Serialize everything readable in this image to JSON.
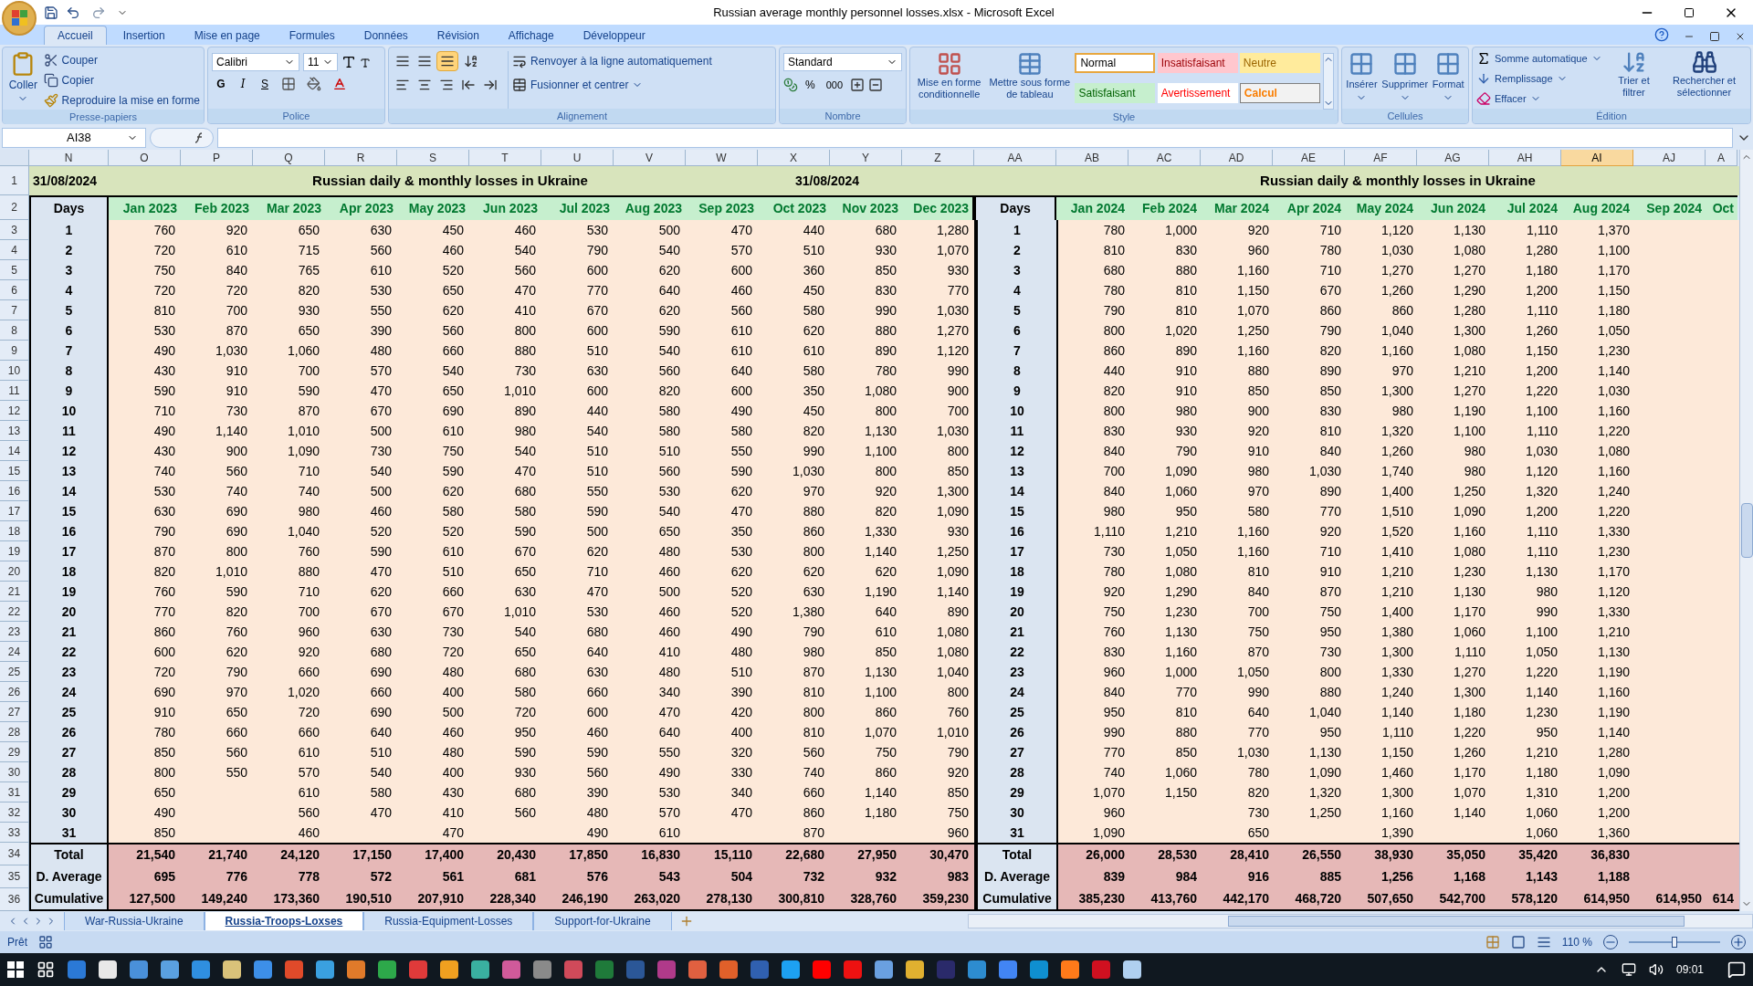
{
  "window": {
    "title": "Russian average monthly personnel losses.xlsx - Microsoft Excel"
  },
  "ribbon": {
    "tabs": [
      {
        "label": "Accueil",
        "selected": true
      },
      {
        "label": "Insertion",
        "selected": false
      },
      {
        "label": "Mise en page",
        "selected": false
      },
      {
        "label": "Formules",
        "selected": false
      },
      {
        "label": "Données",
        "selected": false
      },
      {
        "label": "Révision",
        "selected": false
      },
      {
        "label": "Affichage",
        "selected": false
      },
      {
        "label": "Développeur",
        "selected": false
      }
    ],
    "clipboard": {
      "title": "Presse-papiers",
      "paste": "Coller",
      "cut": "Couper",
      "copy": "Copier",
      "format_painter": "Reproduire la mise en forme"
    },
    "font": {
      "title": "Police",
      "family": "Calibri",
      "size": "11",
      "bold": "G",
      "italic": "I",
      "underline": "S"
    },
    "alignment": {
      "title": "Alignement",
      "wrap": "Renvoyer à la ligne automatiquement",
      "merge": "Fusionner et centrer",
      "valign": [
        {
          "selected": false
        },
        {
          "selected": false
        },
        {
          "selected": true
        }
      ]
    },
    "number": {
      "title": "Nombre",
      "format": "Standard",
      "percent": "%",
      "thousands": "000"
    },
    "styles": {
      "title": "Style",
      "conditional": "Mise en forme conditionnelle",
      "as_table": "Mettre sous forme de tableau",
      "cell_styles": [
        {
          "label": "Normal",
          "kind": "normal"
        },
        {
          "label": "Insatisfaisant",
          "kind": "bad"
        },
        {
          "label": "Neutre",
          "kind": "neutral"
        },
        {
          "label": "Satisfaisant",
          "kind": "good"
        },
        {
          "label": "Avertissement",
          "kind": "warning"
        },
        {
          "label": "Calcul",
          "kind": "calc"
        }
      ]
    },
    "cells": {
      "title": "Cellules",
      "buttons": [
        "Insérer",
        "Supprimer",
        "Format"
      ]
    },
    "editing": {
      "title": "Édition",
      "autosum": "Somme automatique",
      "fill": "Remplissage",
      "clear": "Effacer",
      "sort": "Trier et filtrer",
      "find": "Rechercher et sélectionner"
    }
  },
  "formula_bar": {
    "name_box": "AI38"
  },
  "sheet": {
    "columns": [
      {
        "label": "N",
        "selected": false
      },
      {
        "label": "O",
        "selected": false
      },
      {
        "label": "P",
        "selected": false
      },
      {
        "label": "Q",
        "selected": false
      },
      {
        "label": "R",
        "selected": false
      },
      {
        "label": "S",
        "selected": false
      },
      {
        "label": "T",
        "selected": false
      },
      {
        "label": "U",
        "selected": false
      },
      {
        "label": "V",
        "selected": false
      },
      {
        "label": "W",
        "selected": false
      },
      {
        "label": "X",
        "selected": false
      },
      {
        "label": "Y",
        "selected": false
      },
      {
        "label": "Z",
        "selected": false
      },
      {
        "label": "AA",
        "selected": false
      },
      {
        "label": "AB",
        "selected": false
      },
      {
        "label": "AC",
        "selected": false
      },
      {
        "label": "AD",
        "selected": false
      },
      {
        "label": "AE",
        "selected": false
      },
      {
        "label": "AF",
        "selected": false
      },
      {
        "label": "AG",
        "selected": false
      },
      {
        "label": "AH",
        "selected": false
      },
      {
        "label": "AI",
        "selected": true
      },
      {
        "label": "AJ",
        "selected": false
      },
      {
        "label": "A",
        "selected": false
      }
    ],
    "row_numbers": [
      "1",
      "2",
      "3",
      "4",
      "5",
      "6",
      "7",
      "8",
      "9",
      "10",
      "11",
      "12",
      "13",
      "14",
      "15",
      "16",
      "17",
      "18",
      "19",
      "20",
      "21",
      "22",
      "23",
      "24",
      "25",
      "26",
      "27",
      "28",
      "29",
      "30",
      "31",
      "32",
      "33",
      "34",
      "35",
      "36"
    ],
    "blocks": [
      {
        "date": "31/08/2024",
        "title": "Russian daily & monthly losses in Ukraine",
        "days_label": "Days",
        "days": [
          "1",
          "2",
          "3",
          "4",
          "5",
          "6",
          "7",
          "8",
          "9",
          "10",
          "11",
          "12",
          "13",
          "14",
          "15",
          "16",
          "17",
          "18",
          "19",
          "20",
          "21",
          "22",
          "23",
          "24",
          "25",
          "26",
          "27",
          "28",
          "29",
          "30",
          "31"
        ],
        "summary_labels": [
          "Total",
          "D. Average",
          "Cumulative"
        ],
        "months": [
          {
            "label": "Jan 2023",
            "total": "21,540",
            "average": "695",
            "cumulative": "127,500",
            "values": [
              "760",
              "720",
              "750",
              "720",
              "810",
              "530",
              "490",
              "430",
              "590",
              "710",
              "490",
              "430",
              "740",
              "530",
              "630",
              "790",
              "870",
              "820",
              "760",
              "770",
              "860",
              "600",
              "720",
              "690",
              "910",
              "780",
              "850",
              "800",
              "650",
              "490",
              "850"
            ]
          },
          {
            "label": "Feb 2023",
            "total": "21,740",
            "average": "776",
            "cumulative": "149,240",
            "values": [
              "920",
              "610",
              "840",
              "720",
              "700",
              "870",
              "1,030",
              "910",
              "910",
              "730",
              "1,140",
              "900",
              "560",
              "740",
              "690",
              "690",
              "800",
              "1,010",
              "590",
              "820",
              "760",
              "620",
              "790",
              "970",
              "650",
              "660",
              "560",
              "550"
            ]
          },
          {
            "label": "Mar 2023",
            "total": "24,120",
            "average": "778",
            "cumulative": "173,360",
            "values": [
              "650",
              "715",
              "765",
              "820",
              "930",
              "650",
              "1,060",
              "700",
              "590",
              "870",
              "1,010",
              "1,090",
              "710",
              "740",
              "980",
              "1,040",
              "760",
              "880",
              "710",
              "700",
              "960",
              "920",
              "660",
              "1,020",
              "720",
              "660",
              "610",
              "570",
              "610",
              "560",
              "460"
            ]
          },
          {
            "label": "Apr 2023",
            "total": "17,150",
            "average": "572",
            "cumulative": "190,510",
            "values": [
              "630",
              "560",
              "610",
              "530",
              "550",
              "390",
              "480",
              "570",
              "470",
              "670",
              "500",
              "730",
              "540",
              "500",
              "460",
              "520",
              "590",
              "470",
              "620",
              "670",
              "630",
              "680",
              "690",
              "660",
              "690",
              "640",
              "510",
              "540",
              "580",
              "470"
            ]
          },
          {
            "label": "May 2023",
            "total": "17,400",
            "average": "561",
            "cumulative": "207,910",
            "values": [
              "450",
              "460",
              "520",
              "650",
              "620",
              "560",
              "660",
              "540",
              "650",
              "690",
              "610",
              "750",
              "590",
              "620",
              "580",
              "520",
              "610",
              "510",
              "660",
              "670",
              "730",
              "720",
              "480",
              "400",
              "500",
              "460",
              "480",
              "400",
              "430",
              "410",
              "470"
            ]
          },
          {
            "label": "Jun 2023",
            "total": "20,430",
            "average": "681",
            "cumulative": "228,340",
            "values": [
              "460",
              "540",
              "560",
              "470",
              "410",
              "800",
              "880",
              "730",
              "1,010",
              "890",
              "980",
              "540",
              "470",
              "680",
              "580",
              "590",
              "670",
              "650",
              "630",
              "1,010",
              "540",
              "650",
              "680",
              "580",
              "720",
              "950",
              "590",
              "930",
              "680",
              "560"
            ]
          },
          {
            "label": "Jul 2023",
            "total": "17,850",
            "average": "576",
            "cumulative": "246,190",
            "values": [
              "530",
              "790",
              "600",
              "770",
              "670",
              "600",
              "510",
              "630",
              "600",
              "440",
              "540",
              "510",
              "510",
              "550",
              "590",
              "500",
              "620",
              "710",
              "470",
              "530",
              "680",
              "640",
              "630",
              "660",
              "600",
              "460",
              "590",
              "560",
              "390",
              "480",
              "490"
            ]
          },
          {
            "label": "Aug 2023",
            "total": "16,830",
            "average": "543",
            "cumulative": "263,020",
            "values": [
              "500",
              "540",
              "620",
              "640",
              "620",
              "590",
              "540",
              "560",
              "820",
              "580",
              "580",
              "510",
              "560",
              "530",
              "540",
              "650",
              "480",
              "460",
              "500",
              "460",
              "460",
              "410",
              "480",
              "340",
              "470",
              "640",
              "550",
              "490",
              "530",
              "570",
              "610"
            ]
          },
          {
            "label": "Sep 2023",
            "total": "15,110",
            "average": "504",
            "cumulative": "278,130",
            "values": [
              "470",
              "570",
              "600",
              "460",
              "560",
              "610",
              "610",
              "640",
              "600",
              "490",
              "580",
              "550",
              "590",
              "620",
              "470",
              "350",
              "530",
              "620",
              "520",
              "520",
              "490",
              "480",
              "510",
              "390",
              "420",
              "400",
              "320",
              "330",
              "340",
              "470"
            ]
          },
          {
            "label": "Oct 2023",
            "total": "22,680",
            "average": "732",
            "cumulative": "300,810",
            "values": [
              "440",
              "510",
              "360",
              "450",
              "580",
              "620",
              "610",
              "580",
              "350",
              "450",
              "820",
              "990",
              "1,030",
              "970",
              "880",
              "860",
              "800",
              "620",
              "630",
              "1,380",
              "790",
              "980",
              "870",
              "810",
              "800",
              "810",
              "560",
              "740",
              "660",
              "860",
              "870"
            ]
          },
          {
            "label": "Nov 2023",
            "total": "27,950",
            "average": "932",
            "cumulative": "328,760",
            "values": [
              "680",
              "930",
              "850",
              "830",
              "990",
              "880",
              "890",
              "780",
              "1,080",
              "800",
              "1,130",
              "1,100",
              "800",
              "920",
              "820",
              "1,330",
              "1,140",
              "620",
              "1,190",
              "640",
              "610",
              "850",
              "1,130",
              "1,100",
              "860",
              "1,070",
              "750",
              "860",
              "1,140",
              "1,180"
            ]
          },
          {
            "label": "Dec 2023",
            "total": "30,470",
            "average": "983",
            "cumulative": "359,230",
            "values": [
              "1,280",
              "1,070",
              "930",
              "770",
              "1,030",
              "1,270",
              "1,120",
              "990",
              "900",
              "700",
              "1,030",
              "800",
              "850",
              "1,300",
              "1,090",
              "930",
              "1,250",
              "1,090",
              "1,140",
              "890",
              "1,080",
              "1,080",
              "1,040",
              "800",
              "760",
              "1,010",
              "790",
              "920",
              "850",
              "750",
              "960"
            ]
          }
        ]
      },
      {
        "date": "31/08/2024",
        "title": "Russian daily & monthly losses in Ukraine",
        "days_label": "Days",
        "days": [
          "1",
          "2",
          "3",
          "4",
          "5",
          "6",
          "7",
          "8",
          "9",
          "10",
          "11",
          "12",
          "13",
          "14",
          "15",
          "16",
          "17",
          "18",
          "19",
          "20",
          "21",
          "22",
          "23",
          "24",
          "25",
          "26",
          "27",
          "28",
          "29",
          "30",
          "31"
        ],
        "summary_labels": [
          "Total",
          "D. Average",
          "Cumulative"
        ],
        "months": [
          {
            "label": "Jan 2024",
            "total": "26,000",
            "average": "839",
            "cumulative": "385,230",
            "values": [
              "780",
              "810",
              "680",
              "780",
              "790",
              "800",
              "860",
              "440",
              "820",
              "800",
              "830",
              "840",
              "700",
              "840",
              "980",
              "1,110",
              "730",
              "780",
              "920",
              "750",
              "760",
              "830",
              "960",
              "840",
              "950",
              "990",
              "770",
              "740",
              "1,070",
              "960",
              "1,090"
            ]
          },
          {
            "label": "Feb 2024",
            "total": "28,530",
            "average": "984",
            "cumulative": "413,760",
            "values": [
              "1,000",
              "830",
              "880",
              "810",
              "810",
              "1,020",
              "890",
              "910",
              "910",
              "980",
              "930",
              "790",
              "1,090",
              "1,060",
              "950",
              "1,210",
              "1,050",
              "1,080",
              "1,290",
              "1,230",
              "1,130",
              "1,160",
              "1,000",
              "770",
              "810",
              "880",
              "850",
              "1,060",
              "1,150"
            ]
          },
          {
            "label": "Mar 2024",
            "total": "28,410",
            "average": "916",
            "cumulative": "442,170",
            "values": [
              "920",
              "960",
              "1,160",
              "1,150",
              "1,070",
              "1,250",
              "1,160",
              "880",
              "850",
              "900",
              "920",
              "910",
              "980",
              "970",
              "580",
              "1,160",
              "1,160",
              "810",
              "840",
              "700",
              "750",
              "870",
              "1,050",
              "990",
              "640",
              "770",
              "1,030",
              "780",
              "820",
              "730",
              "650"
            ]
          },
          {
            "label": "Apr 2024",
            "total": "26,550",
            "average": "885",
            "cumulative": "468,720",
            "values": [
              "710",
              "780",
              "710",
              "670",
              "860",
              "790",
              "820",
              "890",
              "850",
              "830",
              "810",
              "840",
              "1,030",
              "890",
              "770",
              "920",
              "710",
              "910",
              "870",
              "750",
              "950",
              "730",
              "800",
              "880",
              "1,040",
              "950",
              "1,130",
              "1,090",
              "1,320",
              "1,250"
            ]
          },
          {
            "label": "May 2024",
            "total": "38,930",
            "average": "1,256",
            "cumulative": "507,650",
            "values": [
              "1,120",
              "1,030",
              "1,270",
              "1,260",
              "860",
              "1,040",
              "1,160",
              "970",
              "1,300",
              "980",
              "1,320",
              "1,260",
              "1,740",
              "1,400",
              "1,510",
              "1,520",
              "1,410",
              "1,210",
              "1,210",
              "1,400",
              "1,380",
              "1,300",
              "1,330",
              "1,240",
              "1,140",
              "1,110",
              "1,150",
              "1,460",
              "1,300",
              "1,160",
              "1,390"
            ]
          },
          {
            "label": "Jun 2024",
            "total": "35,050",
            "average": "1,168",
            "cumulative": "542,700",
            "values": [
              "1,130",
              "1,080",
              "1,270",
              "1,290",
              "1,280",
              "1,300",
              "1,080",
              "1,210",
              "1,270",
              "1,190",
              "1,100",
              "980",
              "980",
              "1,250",
              "1,090",
              "1,160",
              "1,080",
              "1,230",
              "1,130",
              "1,170",
              "1,060",
              "1,110",
              "1,270",
              "1,300",
              "1,180",
              "1,220",
              "1,260",
              "1,170",
              "1,070",
              "1,140"
            ]
          },
          {
            "label": "Jul 2024",
            "total": "35,420",
            "average": "1,143",
            "cumulative": "578,120",
            "values": [
              "1,110",
              "1,280",
              "1,180",
              "1,200",
              "1,110",
              "1,260",
              "1,150",
              "1,200",
              "1,220",
              "1,100",
              "1,110",
              "1,030",
              "1,120",
              "1,320",
              "1,200",
              "1,110",
              "1,110",
              "1,130",
              "980",
              "990",
              "1,100",
              "1,050",
              "1,220",
              "1,140",
              "1,230",
              "950",
              "1,210",
              "1,180",
              "1,310",
              "1,060",
              "1,060"
            ]
          },
          {
            "label": "Aug 2024",
            "total": "36,830",
            "average": "1,188",
            "cumulative": "614,950",
            "values": [
              "1,370",
              "1,100",
              "1,170",
              "1,150",
              "1,180",
              "1,050",
              "1,230",
              "1,140",
              "1,030",
              "1,160",
              "1,220",
              "1,080",
              "1,160",
              "1,240",
              "1,220",
              "1,330",
              "1,230",
              "1,170",
              "1,120",
              "1,330",
              "1,210",
              "1,130",
              "1,190",
              "1,160",
              "1,190",
              "1,140",
              "1,280",
              "1,090",
              "1,200",
              "1,200",
              "1,360"
            ]
          },
          {
            "label": "Sep 2024",
            "cumulative": "614,950"
          },
          {
            "label": "Oct",
            "cumulative": "614"
          }
        ]
      }
    ]
  },
  "sheet_tabs": [
    {
      "label": "War-Russia-Ukraine",
      "selected": false
    },
    {
      "label": "Russia-Troops-Loxses",
      "selected": true
    },
    {
      "label": "Russia-Equipment-Losses",
      "selected": false
    },
    {
      "label": "Support-for-Ukraine",
      "selected": false
    }
  ],
  "status_bar": {
    "status": "Prêt",
    "zoom": "110 %",
    "zoom_slider": {
      "level": 0.5
    }
  },
  "taskbar": {
    "time": "09:01"
  }
}
